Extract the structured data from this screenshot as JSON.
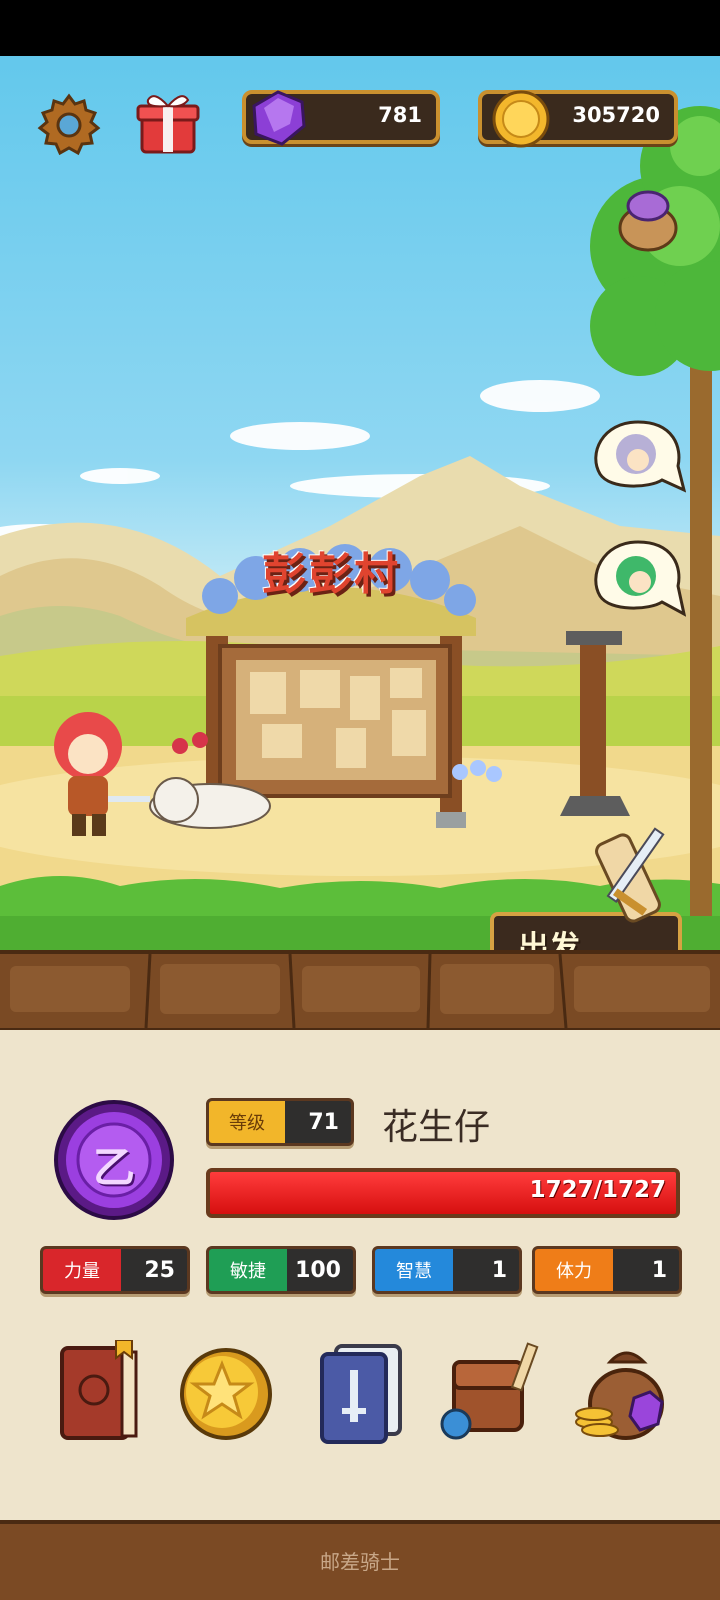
{
  "resources": {
    "gems": "781",
    "gold": "305720"
  },
  "scene": {
    "village_sign": "彭彭村",
    "depart_label": "出发"
  },
  "player": {
    "level_label": "等级",
    "level": "71",
    "name": "花生仔",
    "hp_text": "1727/1727",
    "hp_fraction": 1.0,
    "rank_badge_glyph": "乙"
  },
  "stats": [
    {
      "label": "力量",
      "value": "25",
      "color": "#d9262b"
    },
    {
      "label": "敏捷",
      "value": "100",
      "color": "#1f9e55"
    },
    {
      "label": "智慧",
      "value": "1",
      "color": "#2489db"
    },
    {
      "label": "体力",
      "value": "1",
      "color": "#ef7d18"
    }
  ],
  "menu": [
    "journal-book-icon",
    "star-coin-icon",
    "skill-cards-icon",
    "backpack-icon",
    "treasure-bag-icon"
  ],
  "footer": {
    "title": "邮差骑士"
  }
}
